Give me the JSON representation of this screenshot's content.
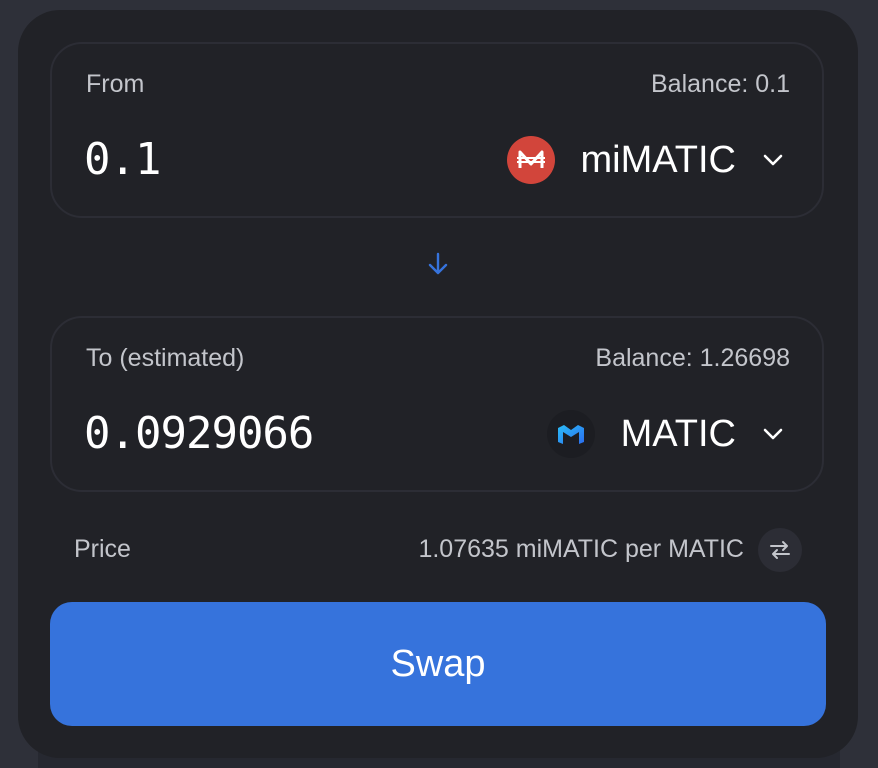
{
  "from": {
    "label": "From",
    "balance": "Balance: 0.1",
    "amount": "0.1",
    "token": {
      "symbol": "miMATIC",
      "icon": "mimatic-token-icon",
      "color": "#d2453b"
    }
  },
  "to": {
    "label": "To (estimated)",
    "balance": "Balance: 1.26698",
    "amount": "0.0929066",
    "token": {
      "symbol": "MATIC",
      "icon": "matic-token-icon",
      "color": "#2b6def"
    }
  },
  "price": {
    "label": "Price",
    "value": "1.07635 miMATIC per MATIC"
  },
  "swap_button": {
    "label": "Swap"
  },
  "colors": {
    "accent": "#3673dc",
    "arrow": "#3673dc",
    "background": "#212227"
  }
}
